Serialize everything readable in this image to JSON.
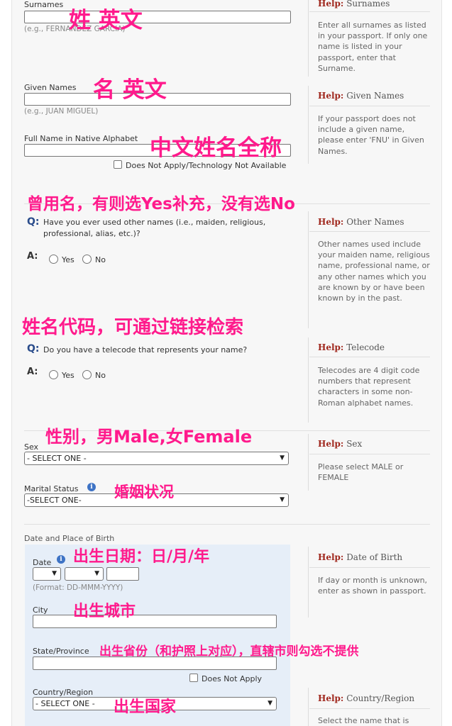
{
  "fields": {
    "surnames": {
      "label": "Surnames",
      "example": "(e.g., FERNANDEZ GARCIA)"
    },
    "given_names": {
      "label": "Given Names",
      "example": "(e.g., JUAN MIGUEL)"
    },
    "full_name_native": {
      "label": "Full Name in Native Alphabet",
      "checkbox_label": "Does Not Apply/Technology Not Available"
    },
    "other_names": {
      "q_marker": "Q:",
      "question": "Have you ever used other names (i.e., maiden, religious, professional, alias, etc.)?",
      "a_marker": "A:",
      "yes": "Yes",
      "no": "No"
    },
    "telecode": {
      "q_marker": "Q:",
      "question": "Do you have a telecode that represents your name?",
      "a_marker": "A:",
      "yes": "Yes",
      "no": "No"
    },
    "sex": {
      "label": "Sex",
      "selected": "- SELECT ONE -"
    },
    "marital_status": {
      "label": "Marital Status",
      "selected": "-SELECT ONE-"
    },
    "birth": {
      "section_label": "Date and Place of Birth",
      "date_label": "Date",
      "date_format": "(Format: DD-MMM-YYYY)",
      "city_label": "City",
      "state_label": "State/Province",
      "state_checkbox": "Does Not Apply",
      "country_label": "Country/Region",
      "country_selected": "- SELECT ONE -"
    }
  },
  "help": {
    "prefix": "Help:",
    "surnames": {
      "title": "Surnames",
      "body": "Enter all surnames as listed in your passport. If only one name is listed in your passport, enter that Surname."
    },
    "given_names": {
      "title": "Given Names",
      "body": "If your passport does not include a given name, please enter 'FNU' in Given Names."
    },
    "other_names": {
      "title": "Other Names",
      "body": "Other names used include your maiden name, religious name, professional name, or any other names which you are known by or have been known by in the past."
    },
    "telecode": {
      "title": "Telecode",
      "body": "Telecodes are 4 digit code numbers that represent characters in some non-Roman alphabet names."
    },
    "sex": {
      "title": "Sex",
      "body": "Please select MALE or FEMALE"
    },
    "dob": {
      "title": "Date of Birth",
      "body": "If day or month is unknown, enter as shown in passport."
    },
    "country": {
      "title": "Country/Region",
      "body": "Select the name that is"
    }
  },
  "annotations": {
    "surname": "姓 英文",
    "given": "名 英文",
    "native": "中文姓名全称",
    "other_names": "曾用名，有则选Yes补充，没有选No",
    "telecode": "姓名代码，可通过链接检索",
    "sex": "性别，男Male,女Female",
    "marital": "婚姻状况",
    "dob": "出生日期：日/月/年",
    "city": "出生城市",
    "province": "出生省份（和护照上对应），直辖市则勾选不提供",
    "country": "出生国家"
  },
  "icons": {
    "info": "info-icon",
    "chevron": "chevron-down-icon"
  },
  "colors": {
    "annotation": "#ff1a8c",
    "question_marker": "#2a4c8b",
    "help_title": "#a0281e",
    "birth_panel": "#e6eef8"
  }
}
